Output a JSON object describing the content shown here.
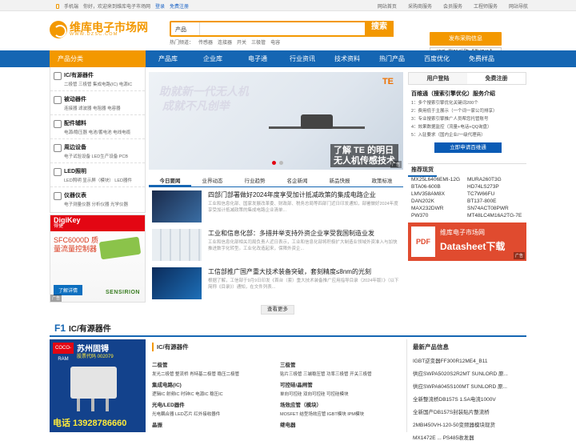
{
  "topbar": {
    "mobile": "手机端",
    "welcome": "你好，欢迎来到维库电子市场网",
    "login": "登录",
    "register": "免费注册",
    "links": [
      "网站首页",
      "采购商服务",
      "会员服务",
      "工程师服务",
      "网站导航"
    ]
  },
  "logo": {
    "cn": "维库电子市场网",
    "en": "WWW.DZSC.COM"
  },
  "search": {
    "category": "产品",
    "placeholder": "",
    "button": "搜索"
  },
  "hot": {
    "label": "热门频道：",
    "items": [
      "传感器",
      "连接器",
      "开关",
      "三极管",
      "电容"
    ]
  },
  "publish": {
    "primary": "发布采购信息",
    "secondary": "修改/删除采购【看报价】"
  },
  "nav": {
    "category": "产品分类",
    "items": [
      "产品库",
      "企业库",
      "电子通",
      "行业资讯",
      "技术资料",
      "热门产品",
      "百度优化",
      "免费样品"
    ]
  },
  "sidebar": [
    {
      "title": "IC/有源器件",
      "sub": "二极管  三极管  集成电路(IC)  电源IC"
    },
    {
      "title": "被动器件",
      "sub": "连接器  滤波器  电阻器  电容器"
    },
    {
      "title": "配件辅料",
      "sub": "电源/稳压器  电池/蓄电池  电线电缆"
    },
    {
      "title": "周边设备",
      "sub": "电子试验设备  LED生产设备  PCB"
    },
    {
      "title": "LED照明",
      "sub": "LED照明  显示屏（模块）  LED器件"
    },
    {
      "title": "仪器仪表",
      "sub": "电子测量仪器  分析仪器  光学仪器"
    }
  ],
  "ad_left": {
    "brand_top": "DigiKey",
    "brand_sub": "得捷",
    "headline": "SFC6000D 质量流量控制器",
    "button": "了解详情",
    "partner": "SENSIRION",
    "tag": "广告"
  },
  "banner": {
    "line1": "助就新一代无人机",
    "line2": "成就不凡创举",
    "brand": "TE",
    "caption1": "了解 TE 的明日",
    "caption2": "无人机传感技术",
    "tag": "广告"
  },
  "news_tabs": [
    "今日要闻",
    "业界动态",
    "行业趋势",
    "名企新闻",
    "新品快报",
    "政策标准"
  ],
  "news": [
    {
      "title": "四部门部署做好2024年度享受加计抵减政策的集成电路企业",
      "summary": "工业和信息化部、国家发展改革委、财政部、税务总局等四部门近日印发通知，部署做好2024年度享受加计抵减政策的集成电路企业清单..."
    },
    {
      "title": "工业和信息化部：多措并举支持外资企业享受我国制造业发",
      "summary": "工业和信息化部相关司局负责人近日表示，工业和信息化部将积极扩大制造业领域外资准入与加快推进数字化转型。工业化改造起来，保障外资企..."
    },
    {
      "title": "工信部推广国产重大技术装备突破，套刻精度≤8nm的光刻",
      "summary": "根据了解，工信部于9月9日印发《首台（套）重大技术装备推广应用指导目录（2024年版）》（以下简称《目录》）通知，在文件列表..."
    }
  ],
  "more": "查看更多",
  "right_tabs": [
    "用户登陆",
    "免费注册"
  ],
  "service": {
    "title": "百维通（搜索引擎优化）服务介绍",
    "lines": [
      "1：多个搜索引擎优化关键词200个",
      "2：费用低于主展示（一个词一家公司排享）",
      "3：专业搜索引擎推广人员帮您托管账号",
      "4：效果数据监控（流量+电话+QQ询盘）",
      "5：入驻要求（国内企业/一级代理商）"
    ],
    "cta": "立即申请百维通"
  },
  "recommend": {
    "title": "推荐现货",
    "items": [
      "MX25L6406EMI-12G",
      "MURA260T3G",
      "BTA06-600B",
      "HD74LS273P",
      "LMV358AM8X",
      "TC7W66FU",
      "DAN202K",
      "BT137-800E",
      "MAX232DWR",
      "SN74ACT08PWR",
      "PW370",
      "MT48LC4M16A2TG-7E"
    ]
  },
  "pdf_ad": {
    "doc": "PDF",
    "line1": "维库电子市场网",
    "line2": "Datasheet下载",
    "tag": "广告"
  },
  "section": {
    "num": "F1",
    "title": "IC/有源器件"
  },
  "ad_bottom": {
    "logo": "COCO-RAM",
    "name": "苏州固锝",
    "sub": "股票代码 002079",
    "tel": "电话 13928786660"
  },
  "categories": {
    "title": "IC/有源器件",
    "left": [
      {
        "name": "二极管",
        "links": "发光二极管  整流桥  肖特基二极管  稳压二极管"
      },
      {
        "name": "集成电路(IC)",
        "links": "逻辑IC  射频IC  时钟IC  电源IC  稳压IC"
      },
      {
        "name": "光电/LED器件",
        "links": "光电耦合器  LED芯片  红外接收器件"
      },
      {
        "name": "晶振",
        "links": ""
      }
    ],
    "right": [
      {
        "name": "三极管",
        "links": "贴片三极管  三端稳压管  功率三极管  开关三极管"
      },
      {
        "name": "可控硅/晶闸管",
        "links": "单向可控硅  双向可控硅  可控硅模块"
      },
      {
        "name": "场效应管（模块）",
        "links": "MOSFET  结型场效应管  IGBT模块  IPM模块"
      },
      {
        "name": "继电器",
        "links": ""
      }
    ]
  },
  "latest": {
    "title": "最新产品信息",
    "items": [
      "IGBT逆变器FF300R12ME4_B11",
      "供应SWPA5020S2R2MT SUNLORD 原...",
      "供应SWPA6045S100MT SUNLORD 原...",
      "全新整流桥DB157S 1.5A电流1000V",
      "全新国产DB157S封装贴片整流桥",
      "2MBI450VH-120-50变频器模块现货",
      "MX1472E ... PS485收发器"
    ]
  }
}
